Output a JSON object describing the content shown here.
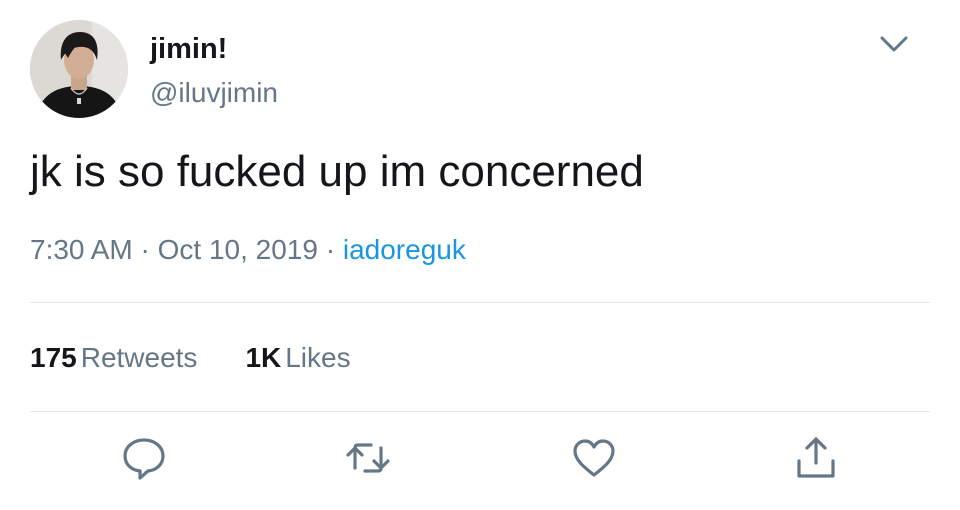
{
  "user": {
    "display_name": "jimin!",
    "handle": "@iluvjimin",
    "avatar_icon": "profile-photo"
  },
  "tweet": {
    "text": "jk is so fucked up im concerned",
    "time": "7:30 AM",
    "date": "Oct 10, 2019",
    "separator": "·",
    "source": "iadoreguk"
  },
  "stats": {
    "retweets_count": "175",
    "retweets_label": "Retweets",
    "likes_count": "1K",
    "likes_label": "Likes"
  },
  "actions": {
    "reply_icon": "reply-icon",
    "retweet_icon": "retweet-icon",
    "like_icon": "heart-icon",
    "share_icon": "share-icon"
  },
  "colors": {
    "text": "#14171a",
    "muted": "#657786",
    "link": "#1b95e0",
    "divider": "#e1e8ed",
    "icon": "#657786"
  }
}
